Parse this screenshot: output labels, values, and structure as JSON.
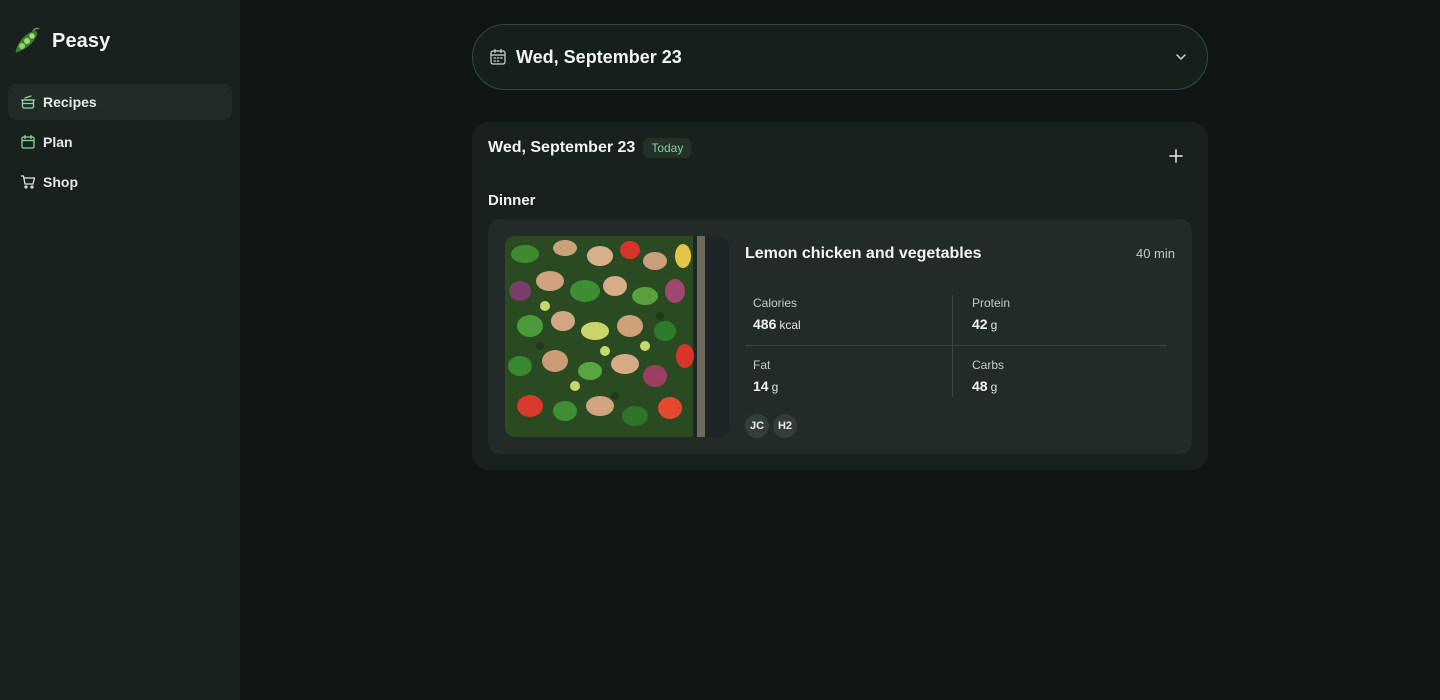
{
  "app": {
    "name": "Peasy"
  },
  "sidebar": {
    "items": [
      {
        "label": "Recipes",
        "icon": "pot-icon",
        "active": true
      },
      {
        "label": "Plan",
        "icon": "calendar-icon",
        "active": false
      },
      {
        "label": "Shop",
        "icon": "cart-icon",
        "active": false
      }
    ]
  },
  "date_picker": {
    "label": "Wed, September 23"
  },
  "day": {
    "title": "Wed, September 23",
    "badge": "Today",
    "meal": "Dinner",
    "recipe": {
      "title": "Lemon chicken and vegetables",
      "time": "40 min",
      "nutrition": {
        "calories": {
          "label": "Calories",
          "value": "486",
          "unit": "kcal"
        },
        "protein": {
          "label": "Protein",
          "value": "42",
          "unit": "g"
        },
        "fat": {
          "label": "Fat",
          "value": "14",
          "unit": "g"
        },
        "carbs": {
          "label": "Carbs",
          "value": "48",
          "unit": "g"
        }
      },
      "assignees": [
        "JC",
        "H2"
      ]
    }
  },
  "colors": {
    "background": "#0f1613",
    "sidebar": "#18211d",
    "accent": "#7fd39b"
  }
}
